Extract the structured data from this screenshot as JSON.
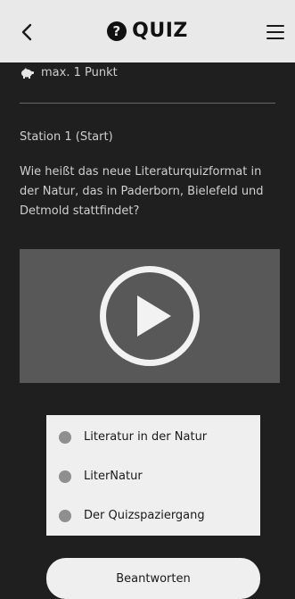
{
  "header": {
    "back_icon": "chevron-left-icon",
    "title": "QUIZ",
    "title_icon": "question-circle-icon",
    "title_icon_glyph": "?",
    "menu_icon": "hamburger-menu-icon"
  },
  "points_label": "max. 1 Punkt",
  "station_label": "Station 1 (Start)",
  "question_text": "Wie heißt das neue Literaturquizformat in der Natur, das in Paderborn, Bielefeld und Detmold stattfindet?",
  "answers": [
    {
      "label": "Literatur in der Natur"
    },
    {
      "label": "LiterNatur"
    },
    {
      "label": "Der Quizspaziergang"
    }
  ],
  "submit_label": "Beantworten",
  "colors": {
    "background": "#1f1f1f",
    "header": "#e9e9e9",
    "video_panel": "#585858",
    "radio": "#8f8f8f"
  }
}
